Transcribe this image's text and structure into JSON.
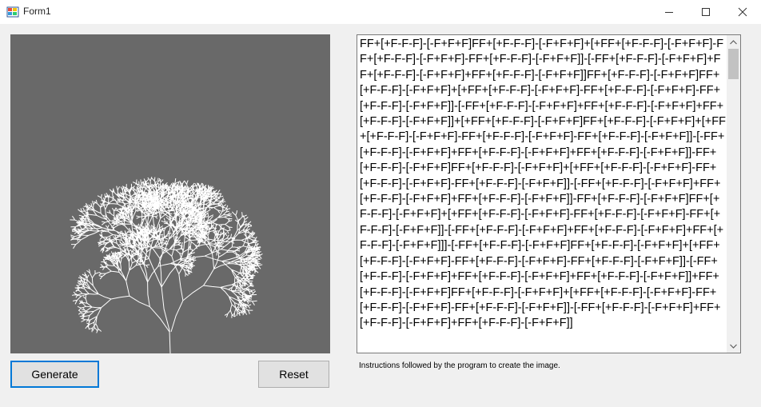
{
  "window": {
    "title": "Form1",
    "icons": {
      "app": "form-app-icon",
      "minimize": "minimize-icon",
      "maximize": "maximize-icon",
      "close": "close-icon"
    }
  },
  "canvas": {
    "background": "#696969",
    "stroke": "#ffffff",
    "content": "l-system-fractal-plant"
  },
  "buttons": {
    "generate": "Generate",
    "reset": "Reset"
  },
  "instructions": {
    "text": "FF+[+F-F-F]-[-F+F+F]FF+[+F-F-F]-[-F+F+F]+[+FF+[+F-F-F]-[-F+F+F]-FF+[+F-F-F]-[-F+F+F]-FF+[+F-F-F]-[-F+F+F]]-[-FF+[+F-F-F]-[-F+F+F]+FF+[+F-F-F]-[-F+F+F]+FF+[+F-F-F]-[-F+F+F]]FF+[+F-F-F]-[-F+F+F]FF+[+F-F-F]-[-F+F+F]+[+FF+[+F-F-F]-[-F+F+F]-FF+[+F-F-F]-[-F+F+F]-FF+[+F-F-F]-[-F+F+F]]-[-FF+[+F-F-F]-[-F+F+F]+FF+[+F-F-F]-[-F+F+F]+FF+[+F-F-F]-[-F+F+F]]+[+FF+[+F-F-F]-[-F+F+F]FF+[+F-F-F]-[-F+F+F]+[+FF+[+F-F-F]-[-F+F+F]-FF+[+F-F-F]-[-F+F+F]-FF+[+F-F-F]-[-F+F+F]]-[-FF+[+F-F-F]-[-F+F+F]+FF+[+F-F-F]-[-F+F+F]+FF+[+F-F-F]-[-F+F+F]]-FF+[+F-F-F]-[-F+F+F]FF+[+F-F-F]-[-F+F+F]+[+FF+[+F-F-F]-[-F+F+F]-FF+[+F-F-F]-[-F+F+F]-FF+[+F-F-F]-[-F+F+F]]-[-FF+[+F-F-F]-[-F+F+F]+FF+[+F-F-F]-[-F+F+F]+FF+[+F-F-F]-[-F+F+F]]-FF+[+F-F-F]-[-F+F+F]FF+[+F-F-F]-[-F+F+F]+[+FF+[+F-F-F]-[-F+F+F]-FF+[+F-F-F]-[-F+F+F]-FF+[+F-F-F]-[-F+F+F]]-[-FF+[+F-F-F]-[-F+F+F]+FF+[+F-F-F]-[-F+F+F]+FF+[+F-F-F]-[-F+F+F]]]-[-FF+[+F-F-F]-[-F+F+F]FF+[+F-F-F]-[-F+F+F]+[+FF+[+F-F-F]-[-F+F+F]-FF+[+F-F-F]-[-F+F+F]-FF+[+F-F-F]-[-F+F+F]]-[-FF+[+F-F-F]-[-F+F+F]+FF+[+F-F-F]-[-F+F+F]+FF+[+F-F-F]-[-F+F+F]]+FF+[+F-F-F]-[-F+F+F]FF+[+F-F-F]-[-F+F+F]+[+FF+[+F-F-F]-[-F+F+F]-FF+[+F-F-F]-[-F+F+F]-FF+[+F-F-F]-[-F+F+F]]-[-FF+[+F-F-F]-[-F+F+F]+FF+[+F-F-F]-[-F+F+F]+FF+[+F-F-F]-[-F+F+F]]",
    "caption": "Instructions followed by the program to create the image."
  },
  "scrollbar": {
    "up": "scroll-up-arrow-icon",
    "down": "scroll-down-arrow-icon"
  }
}
